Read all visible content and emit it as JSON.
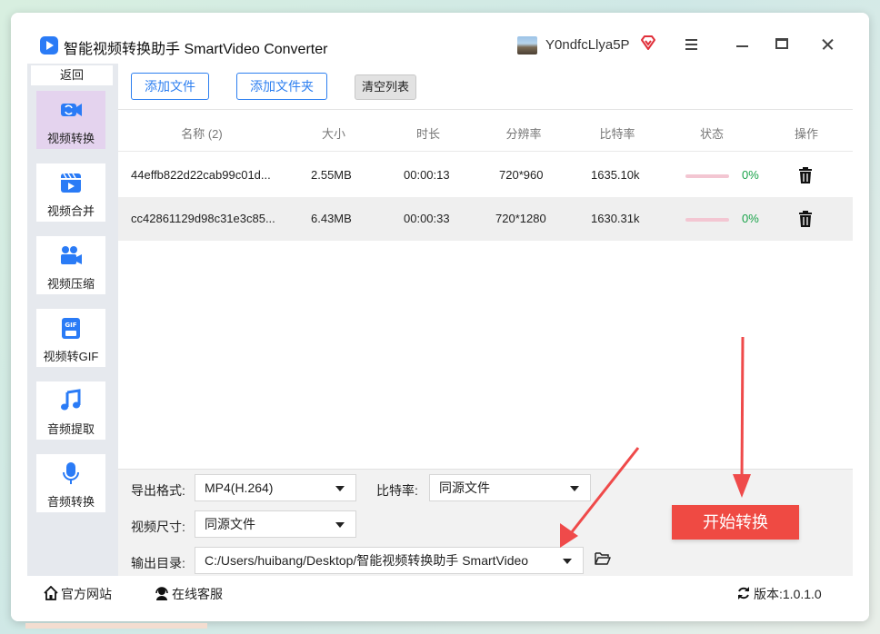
{
  "app": {
    "title": "智能视频转换助手 SmartVideo Converter",
    "username": "Y0ndfcLlya5P"
  },
  "sidebar": {
    "back": "返回",
    "items": [
      {
        "label": "视频转换",
        "icon": "video-convert-icon",
        "active": true
      },
      {
        "label": "视频合并",
        "icon": "video-merge-icon",
        "active": false
      },
      {
        "label": "视频压缩",
        "icon": "video-compress-icon",
        "active": false
      },
      {
        "label": "视频转GIF",
        "icon": "gif-icon",
        "active": false
      },
      {
        "label": "音频提取",
        "icon": "music-note-icon",
        "active": false
      },
      {
        "label": "音频转换",
        "icon": "microphone-icon",
        "active": false
      }
    ]
  },
  "toolbar": {
    "add_file": "添加文件",
    "add_folder": "添加文件夹",
    "clear_list": "清空列表"
  },
  "table": {
    "headers": {
      "name": "名称 (2)",
      "size": "大小",
      "duration": "时长",
      "resolution": "分辨率",
      "bitrate": "比特率",
      "status": "状态",
      "action": "操作"
    },
    "rows": [
      {
        "name": "44effb822d22cab99c01d...",
        "size": "2.55MB",
        "duration": "00:00:13",
        "resolution": "720*960",
        "bitrate": "1635.10k",
        "progress": "0%"
      },
      {
        "name": "cc42861129d98c31e3c85...",
        "size": "6.43MB",
        "duration": "00:00:33",
        "resolution": "720*1280",
        "bitrate": "1630.31k",
        "progress": "0%"
      }
    ]
  },
  "settings": {
    "format_label": "导出格式:",
    "format_value": "MP4(H.264)",
    "bitrate_label": "比特率:",
    "bitrate_value": "同源文件",
    "size_label": "视频尺寸:",
    "size_value": "同源文件",
    "output_label": "输出目录:",
    "output_value": "C:/Users/huibang/Desktop/智能视频转换助手 SmartVideo"
  },
  "start_button": "开始转换",
  "footer": {
    "website": "官方网站",
    "support": "在线客服",
    "version": "版本:1.0.1.0"
  },
  "colors": {
    "accent": "#2d7ff0",
    "start": "#ef4a43",
    "arrow": "#ef4a4a",
    "progress": "#1aa34a"
  }
}
